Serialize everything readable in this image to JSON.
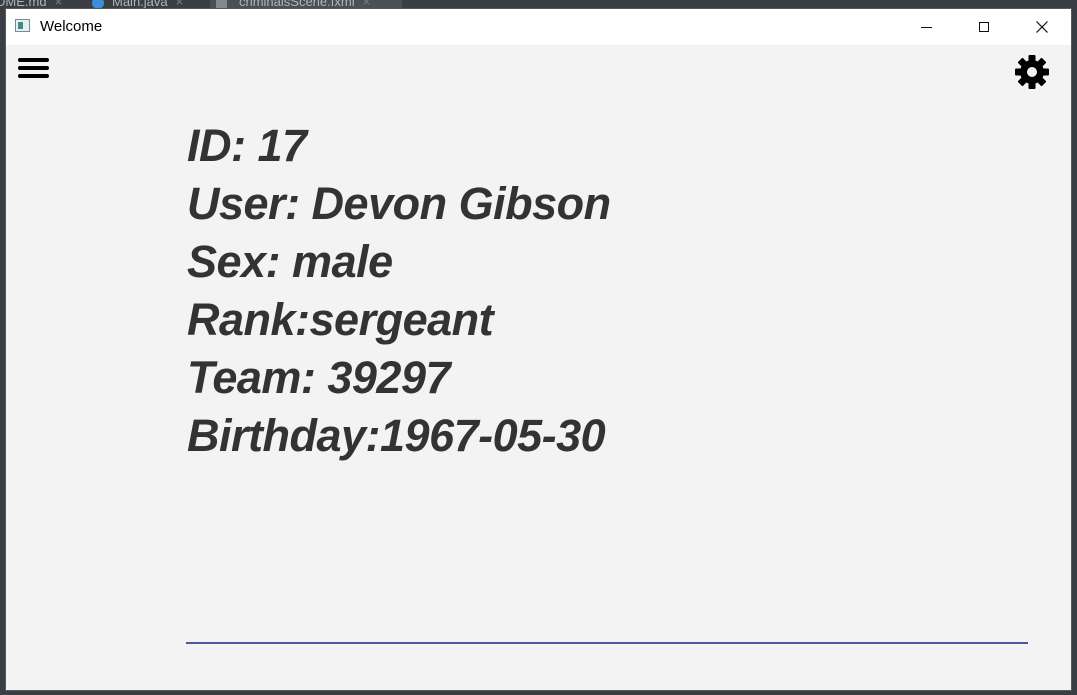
{
  "background_tabs": [
    {
      "label": "DME.md",
      "close": "×"
    },
    {
      "label": "Main.java",
      "close": "×"
    },
    {
      "label": "criminalsScene.fxml",
      "close": "×"
    }
  ],
  "window": {
    "title": "Welcome",
    "controls": {
      "close_glyph": "✕"
    }
  },
  "toolbar": {
    "menu_icon": "hamburger-menu-icon",
    "settings_icon": "gear-icon"
  },
  "profile": {
    "id_line": "ID: 17",
    "user_line": "User: Devon Gibson",
    "sex_line": "Sex: male",
    "rank_line": "Rank:sergeant",
    "team_line": "Team: 39297",
    "birthday_line": "Birthday:1967-05-30"
  },
  "colors": {
    "text": "#333333",
    "accent_line": "#4a5a9c",
    "content_bg": "#f3f3f3"
  }
}
